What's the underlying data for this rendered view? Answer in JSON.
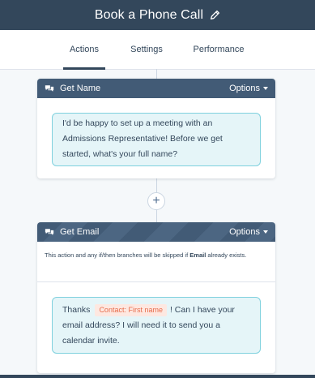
{
  "header": {
    "title": "Book a Phone Call",
    "edit_icon": "pencil-icon"
  },
  "tabs": [
    {
      "label": "Actions",
      "active": true
    },
    {
      "label": "Settings",
      "active": false
    },
    {
      "label": "Performance",
      "active": false
    }
  ],
  "cards": [
    {
      "title": "Get Name",
      "options_label": "Options",
      "icon": "chat-bubbles-icon",
      "message": "I'd be happy to set up a meeting with an Admissions Representative! Before we get started, what's your full name?"
    },
    {
      "title": "Get Email",
      "options_label": "Options",
      "icon": "chat-bubbles-icon",
      "note_prefix": "This action and any if/then branches will be skipped if",
      "note_bold": "Email",
      "note_suffix": "already exists.",
      "message_before": "Thanks",
      "token": "Contact: First name",
      "message_after": "! Can I have your email address? I will need it to send you a calendar invite."
    }
  ],
  "add_action_symbol": "+",
  "colors": {
    "header_bg": "#33475b",
    "card_header_bg": "#425b76",
    "bubble_bg": "#e5f5f8",
    "bubble_border": "#7fd1de",
    "token_text": "#e86c4b"
  }
}
